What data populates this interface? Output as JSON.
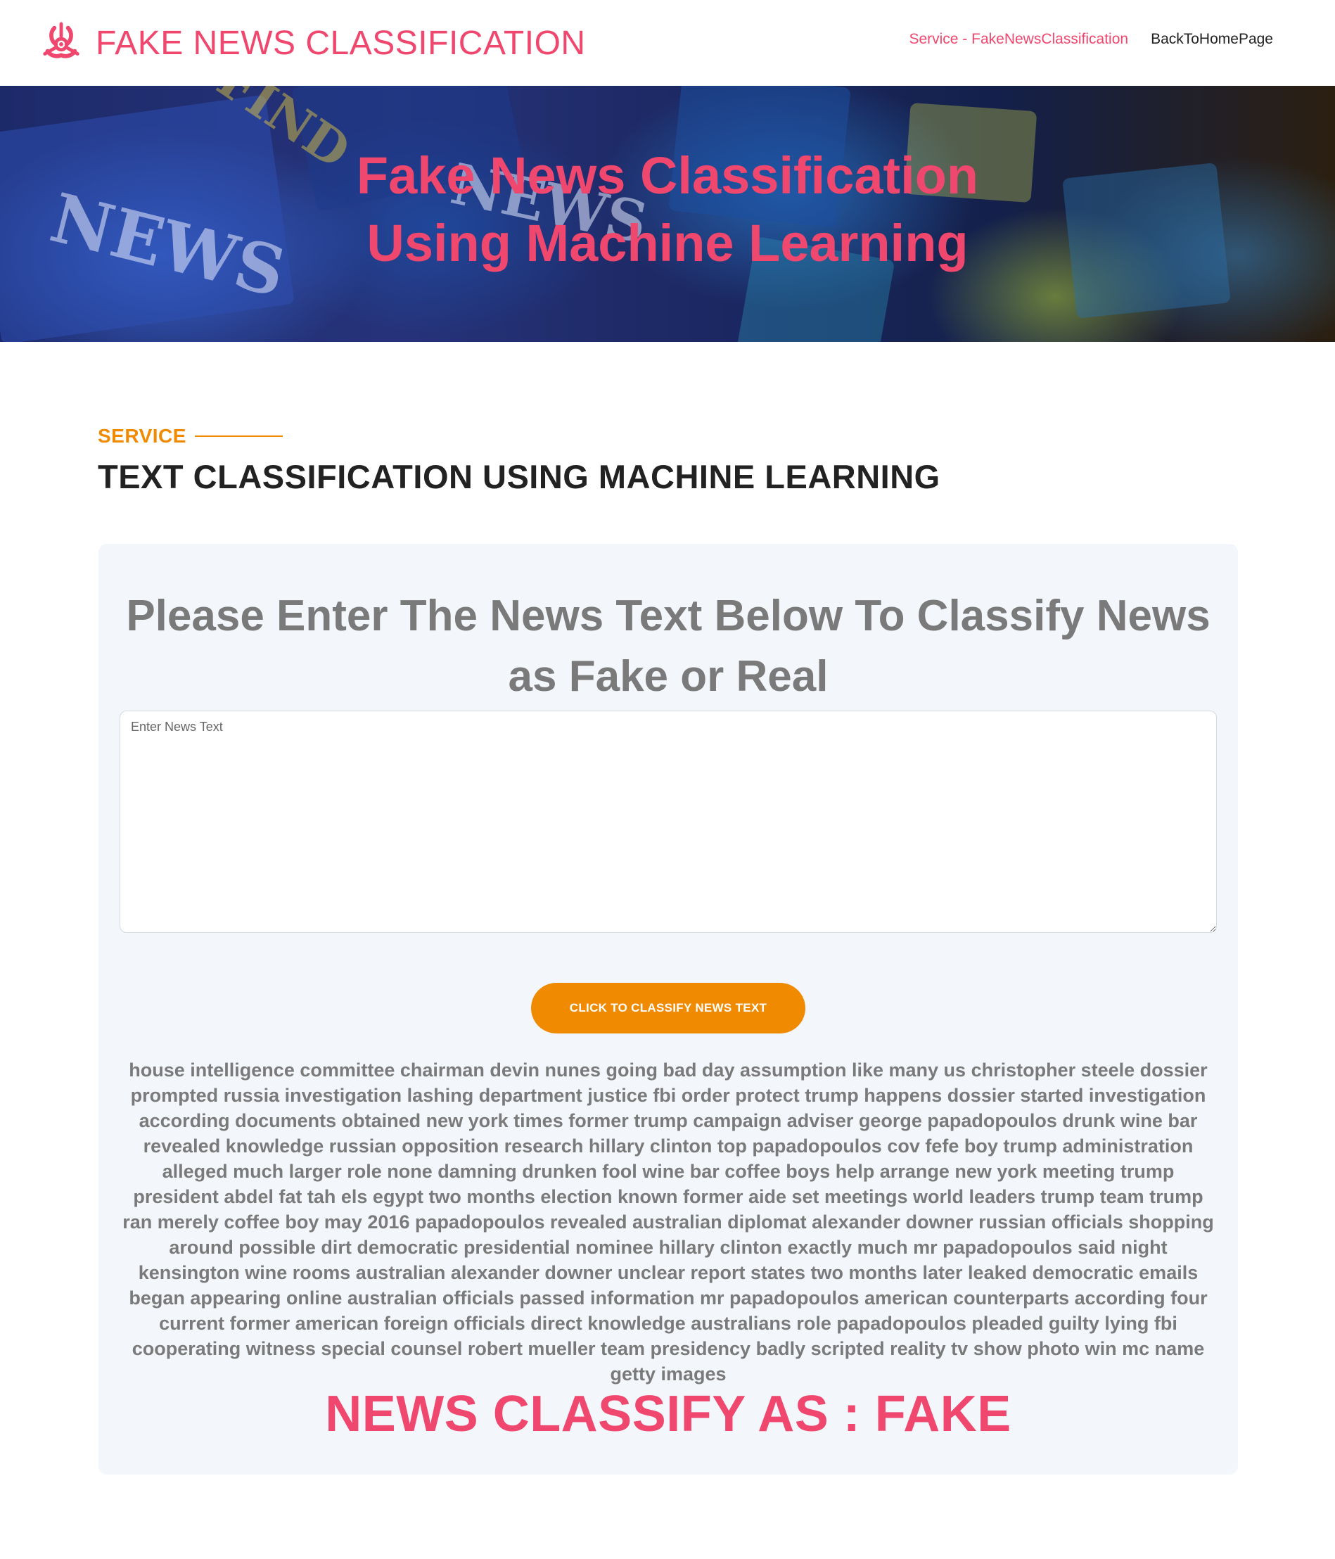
{
  "header": {
    "brand_title": "FAKE NEWS CLASSIFICATION",
    "brand_icon": "biohazard-icon",
    "nav": {
      "service_label": "Service - FakeNewsClassification",
      "home_label": "BackToHomePage"
    }
  },
  "hero": {
    "title_line1": "Fake News Classification",
    "title_line2": "Using Machine Learning"
  },
  "section": {
    "eyebrow": "SERVICE",
    "title": "TEXT CLASSIFICATION USING MACHINE LEARNING"
  },
  "form": {
    "prompt": "Please Enter The News Text Below To Classify News as Fake or Real",
    "input_placeholder": "Enter News Text",
    "input_value": "",
    "button_label": "CLICK TO CLASSIFY NEWS TEXT"
  },
  "result": {
    "processed_text": "house intelligence committee chairman devin nunes going bad day assumption like many us christopher steele dossier prompted russia investigation lashing department justice fbi order protect trump happens dossier started investigation according documents obtained new york times former trump campaign adviser george papadopoulos drunk wine bar revealed knowledge russian opposition research hillary clinton top papadopoulos cov fefe boy trump administration alleged much larger role none damning drunken fool wine bar coffee boys help arrange new york meeting trump president abdel fat tah els egypt two months election known former aide set meetings world leaders trump team trump ran merely coffee boy may 2016 papadopoulos revealed australian diplomat alexander downer russian officials shopping around possible dirt democratic presidential nominee hillary clinton exactly much mr papadopoulos said night kensington wine rooms australian alexander downer unclear report states two months later leaked democratic emails began appearing online australian officials passed information mr papadopoulos american counterparts according four current former american foreign officials direct knowledge australians role papadopoulos pleaded guilty lying fbi cooperating witness special counsel robert mueller team presidency badly scripted reality tv show photo win mc name getty images",
    "verdict": "NEWS CLASSIFY AS : FAKE"
  },
  "colors": {
    "accent_pink": "#f0476e",
    "accent_orange": "#f08a00",
    "card_bg": "#f3f6fb",
    "muted_text": "#7a7a7a"
  }
}
